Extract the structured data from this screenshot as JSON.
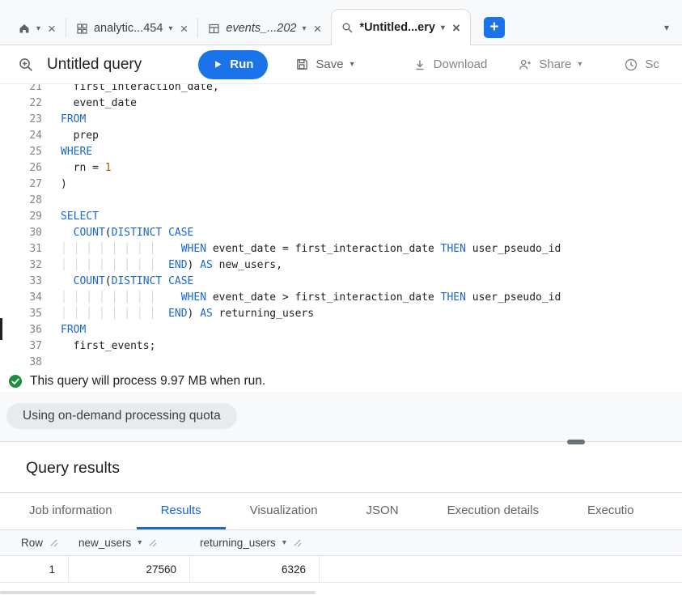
{
  "icons": {
    "caret": "▾",
    "close": "×",
    "plus": "+"
  },
  "tab_strip": {
    "tabs": [
      {
        "name": "home",
        "label": ""
      },
      {
        "name": "analytics-dataset",
        "label": "analytic...454"
      },
      {
        "name": "events-table",
        "label": "events_...202",
        "italic": true
      },
      {
        "name": "untitled-query",
        "label": "*Untitled...ery",
        "active": true
      }
    ],
    "add_label": "+"
  },
  "toolbar": {
    "title": "Untitled query",
    "run_label": "Run",
    "save_label": "Save",
    "download_label": "Download",
    "share_label": "Share",
    "schedule_label": "Sc"
  },
  "editor": {
    "lines": [
      {
        "no": "21",
        "tokens": [
          [
            "p",
            "  first_interaction_date,"
          ]
        ]
      },
      {
        "no": "22",
        "tokens": [
          [
            "p",
            "  event_date"
          ]
        ]
      },
      {
        "no": "23",
        "tokens": [
          [
            "k",
            "FROM"
          ]
        ]
      },
      {
        "no": "24",
        "tokens": [
          [
            "p",
            "  prep"
          ]
        ]
      },
      {
        "no": "25",
        "tokens": [
          [
            "k",
            "WHERE"
          ]
        ]
      },
      {
        "no": "26",
        "tokens": [
          [
            "p",
            "  rn = "
          ],
          [
            "n",
            "1"
          ]
        ]
      },
      {
        "no": "27",
        "tokens": [
          [
            "p",
            ")"
          ]
        ]
      },
      {
        "no": "28",
        "tokens": []
      },
      {
        "no": "29",
        "tokens": [
          [
            "k",
            "SELECT"
          ]
        ]
      },
      {
        "no": "30",
        "tokens": [
          [
            "p",
            "  "
          ],
          [
            "k",
            "COUNT"
          ],
          [
            "p",
            "("
          ],
          [
            "k",
            "DISTINCT"
          ],
          [
            "p",
            " "
          ],
          [
            "k",
            "CASE"
          ]
        ]
      },
      {
        "no": "31",
        "tokens": [
          [
            "g",
            "│ │ │ │ │ │ │ │ "
          ],
          [
            "p",
            "   "
          ],
          [
            "k",
            "WHEN"
          ],
          [
            "p",
            " event_date = first_interaction_date "
          ],
          [
            "k",
            "THEN"
          ],
          [
            "p",
            " user_pseudo_id"
          ]
        ]
      },
      {
        "no": "32",
        "tokens": [
          [
            "g",
            "│ │ │ │ │ │ │ │ "
          ],
          [
            "p",
            " "
          ],
          [
            "k",
            "END"
          ],
          [
            "p",
            ") "
          ],
          [
            "k",
            "AS"
          ],
          [
            "p",
            " new_users,"
          ]
        ]
      },
      {
        "no": "33",
        "tokens": [
          [
            "p",
            "  "
          ],
          [
            "k",
            "COUNT"
          ],
          [
            "p",
            "("
          ],
          [
            "k",
            "DISTINCT"
          ],
          [
            "p",
            " "
          ],
          [
            "k",
            "CASE"
          ]
        ]
      },
      {
        "no": "34",
        "tokens": [
          [
            "g",
            "│ │ │ │ │ │ │ │ "
          ],
          [
            "p",
            "   "
          ],
          [
            "k",
            "WHEN"
          ],
          [
            "p",
            " event_date > first_interaction_date "
          ],
          [
            "k",
            "THEN"
          ],
          [
            "p",
            " user_pseudo_id"
          ]
        ]
      },
      {
        "no": "35",
        "tokens": [
          [
            "g",
            "│ │ │ │ │ │ │ │ "
          ],
          [
            "p",
            " "
          ],
          [
            "k",
            "END"
          ],
          [
            "p",
            ") "
          ],
          [
            "k",
            "AS"
          ],
          [
            "p",
            " returning_users"
          ]
        ]
      },
      {
        "no": "36",
        "tokens": [
          [
            "k",
            "FROM"
          ]
        ]
      },
      {
        "no": "37",
        "tokens": [
          [
            "p",
            "  first_events;"
          ]
        ]
      },
      {
        "no": "38",
        "tokens": []
      }
    ]
  },
  "status": {
    "message": "This query will process 9.97 MB when run."
  },
  "quota": {
    "label": "Using on-demand processing quota"
  },
  "results": {
    "heading": "Query results",
    "tabs": [
      {
        "label": "Job information"
      },
      {
        "label": "Results",
        "active": true
      },
      {
        "label": "Visualization"
      },
      {
        "label": "JSON"
      },
      {
        "label": "Execution details"
      },
      {
        "label": "Executio"
      }
    ],
    "table": {
      "headers": [
        {
          "label": "Row",
          "caret": false
        },
        {
          "label": "new_users",
          "caret": true
        },
        {
          "label": "returning_users",
          "caret": true
        }
      ],
      "rows": [
        [
          "1",
          "27560",
          "6326"
        ]
      ]
    }
  },
  "colors": {
    "accent": "#1a73e8",
    "keyword": "#1967d2",
    "active_tab": "#1967d2",
    "status_ok": "#1e8e3e"
  }
}
